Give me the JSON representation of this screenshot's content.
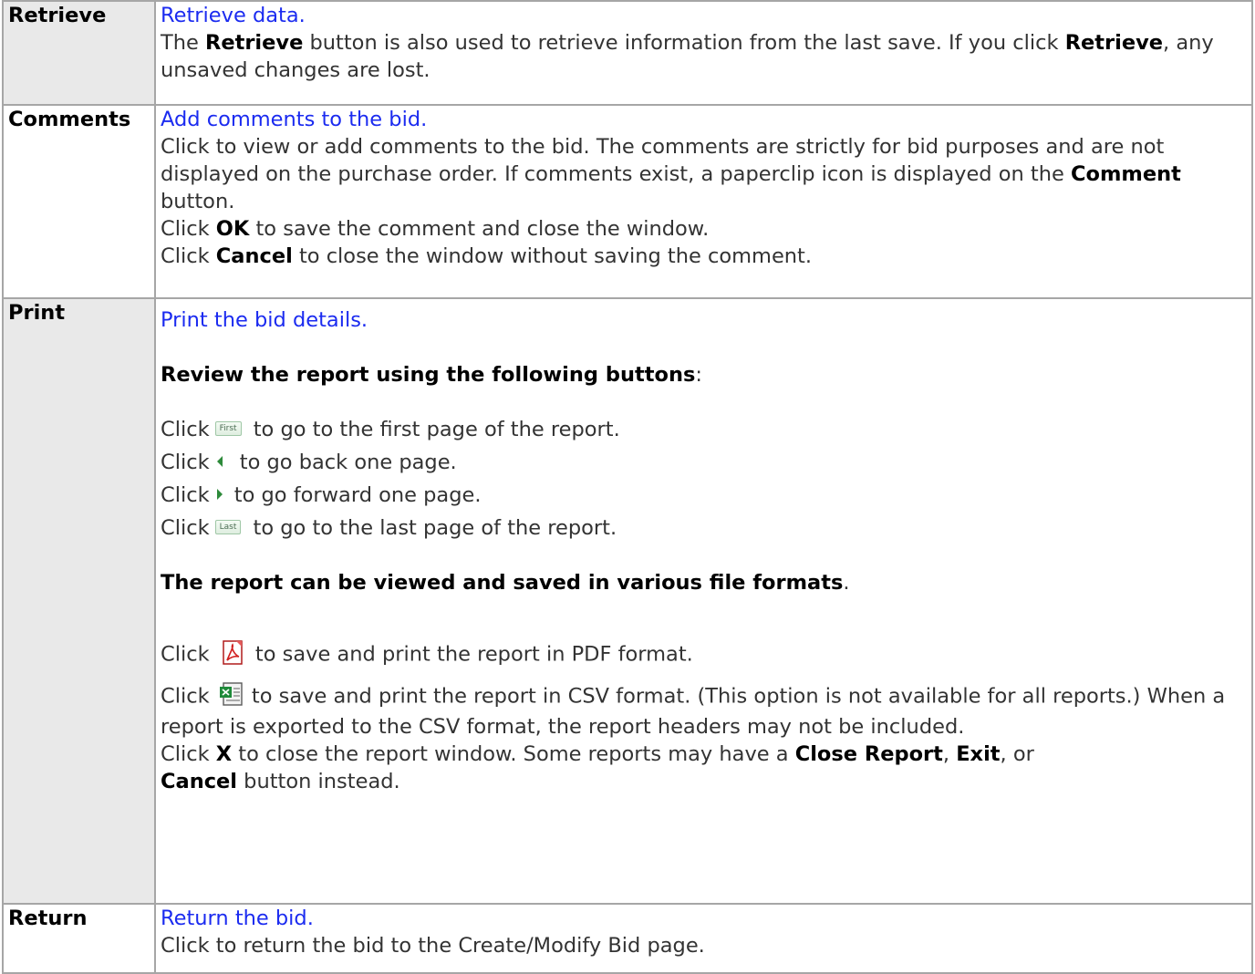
{
  "rows": [
    {
      "name": "Retrieve",
      "link": "Retrieve data.",
      "desc1": "The ",
      "desc_b1": "Retrieve",
      "desc2": " button is also used to retrieve information from the last save. If you click ",
      "desc_b2": "Retrieve",
      "desc3": ", any unsaved changes are lost."
    },
    {
      "name": "Comments",
      "link": "Add comments to the bid.",
      "desc1": "Click to view or add comments to the bid. The comments are strictly for bid purposes and are not displayed on the purchase order. If comments exist, a paperclip icon is displayed on the ",
      "desc_b1": "Comment",
      "desc2": " button.",
      "ok_pre": "Click ",
      "ok_b": "OK",
      "ok_post": " to save the comment and close the window.",
      "cancel_pre": "Click ",
      "cancel_b": "Cancel",
      "cancel_post": " to close the window without saving the comment."
    },
    {
      "name": "Print",
      "link": "Print the bid details.",
      "review_heading": "Review the report using the following buttons",
      "review_colon": ":",
      "click": "Click",
      "first_btn": "First",
      "first_text": " to go to the first page of the report.",
      "back_text": " to go back one page.",
      "forward_text": " to go forward one page.",
      "last_btn": "Last",
      "last_text": " to go to the last page of the report.",
      "formats_heading": "The report can be viewed and saved in various file formats",
      "formats_period": ".",
      "pdf_text": " to save and print the report in PDF format.",
      "csv_text": " to save and print the report in CSV format. (This option is not available for all reports.) When a report is exported to the CSV format, the report headers may not be included.",
      "x_pre": "Click ",
      "x_b": "X",
      "x_mid": " to close the report window. Some reports may have a ",
      "close_b": "Close Report",
      "comma1": ", ",
      "exit_b": "Exit",
      "comma2": ", or",
      "cancel_b": "Cancel",
      "x_post": " button instead."
    },
    {
      "name": "Return",
      "link": "Return the bid.",
      "desc1": "Click to return the bid to the Create/Modify Bid page."
    }
  ],
  "icons": {
    "back": "triangle-left-icon",
    "forward": "triangle-right-icon",
    "pdf": "pdf-icon",
    "csv": "csv-icon"
  },
  "colors": {
    "link": "#1b2bf0",
    "border": "#a6a6a6",
    "name_bg": "#e9e9e9"
  }
}
